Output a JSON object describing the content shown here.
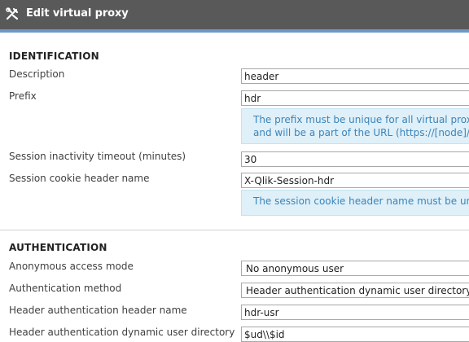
{
  "window": {
    "title": "Edit virtual proxy",
    "icon": "tools-icon"
  },
  "colors": {
    "titlebar": "#595959",
    "accent": "#6c99c7",
    "info_bg": "#dff0f9",
    "info_text": "#3c84b8"
  },
  "identification": {
    "heading": "IDENTIFICATION",
    "description_label": "Description",
    "description_value": "header",
    "prefix_label": "Prefix",
    "prefix_value": "hdr",
    "prefix_info_line1": "The prefix must be unique for all virtual proxies",
    "prefix_info_line2": "and will be a part of the URL (https://[node]/[pre",
    "timeout_label": "Session inactivity timeout (minutes)",
    "timeout_value": "30",
    "cookie_label": "Session cookie header name",
    "cookie_value": "X-Qlik-Session-hdr",
    "cookie_info": "The session cookie header name must be uniqu"
  },
  "authentication": {
    "heading": "AUTHENTICATION",
    "anonymous_label": "Anonymous access mode",
    "anonymous_value": "No anonymous user",
    "method_label": "Authentication method",
    "method_value": "Header authentication dynamic user directory",
    "header_name_label": "Header authentication header name",
    "header_name_value": "hdr-usr",
    "dynamic_dir_label": "Header authentication dynamic user directory",
    "dynamic_dir_value": "$ud\\\\$id"
  }
}
